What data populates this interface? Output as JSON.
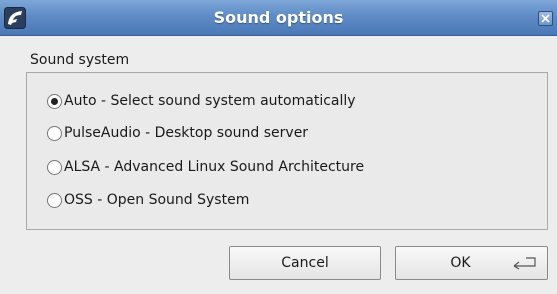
{
  "window": {
    "title": "Sound options",
    "icons": {
      "app": "app-logo-icon",
      "close": "close-icon"
    }
  },
  "sound_system": {
    "label": "Sound system",
    "options": [
      {
        "label": "Auto - Select sound system automatically",
        "checked": true
      },
      {
        "label": "PulseAudio - Desktop sound server",
        "checked": false
      },
      {
        "label": "ALSA - Advanced Linux Sound Architecture",
        "checked": false
      },
      {
        "label": "OSS - Open Sound System",
        "checked": false
      }
    ]
  },
  "buttons": {
    "cancel": "Cancel",
    "ok": "OK",
    "ok_icon": "enter-key-icon"
  },
  "colors": {
    "titlebar": "#5f8cc6",
    "background": "#ededed"
  }
}
